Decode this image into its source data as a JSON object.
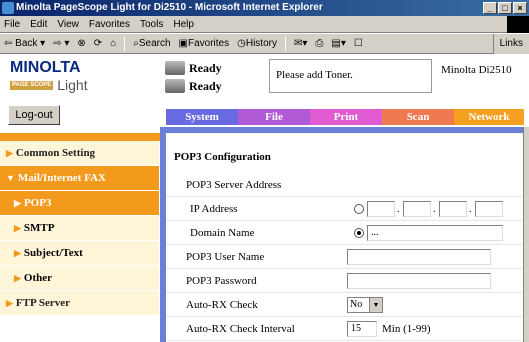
{
  "window": {
    "title": "Minolta PageScope Light for Di2510 - Microsoft Internet Explorer",
    "controls": [
      "_",
      "□",
      "×"
    ]
  },
  "menubar": [
    "File",
    "Edit",
    "View",
    "Favorites",
    "Tools",
    "Help"
  ],
  "toolbar": {
    "back": "Back",
    "search": "Search",
    "favorites": "Favorites",
    "history": "History",
    "links": "Links"
  },
  "header": {
    "brand": "MINOLTA",
    "product": "PAGE SCOPE Light",
    "status1": "Ready",
    "status2": "Ready",
    "message": "Please add Toner.",
    "model": "Minolta Di2510",
    "logout": "Log-out"
  },
  "tabs": [
    {
      "label": "System",
      "color": "#6a6ae0"
    },
    {
      "label": "File",
      "color": "#b05ad8"
    },
    {
      "label": "Print",
      "color": "#e05ad0"
    },
    {
      "label": "Scan",
      "color": "#f07a50"
    },
    {
      "label": "Network",
      "color": "#f5a020"
    }
  ],
  "sidebar": [
    {
      "label": "Common Setting",
      "type": "top"
    },
    {
      "label": "Mail/Internet FAX",
      "type": "open"
    },
    {
      "label": "POP3",
      "type": "active"
    },
    {
      "label": "SMTP",
      "type": "sub"
    },
    {
      "label": "Subject/Text",
      "type": "sub"
    },
    {
      "label": "Other",
      "type": "sub"
    },
    {
      "label": "FTP Server",
      "type": "top"
    }
  ],
  "form": {
    "title": "POP3 Configuration",
    "server_address": "POP3 Server Address",
    "ip_address": "IP Address",
    "domain_name": "Domain Name",
    "domain_value": "...",
    "user_name": "POP3 User Name",
    "password": "POP3 Password",
    "auto_rx": "Auto-RX Check",
    "auto_rx_value": "No",
    "interval": "Auto-RX Check Interval",
    "interval_value": "15",
    "interval_unit": "Min (1-99)"
  },
  "colors": {
    "orange": "#f39a1c",
    "frame_blue": "#6b7fd6",
    "sidebar_bg": "#fff5d8"
  }
}
